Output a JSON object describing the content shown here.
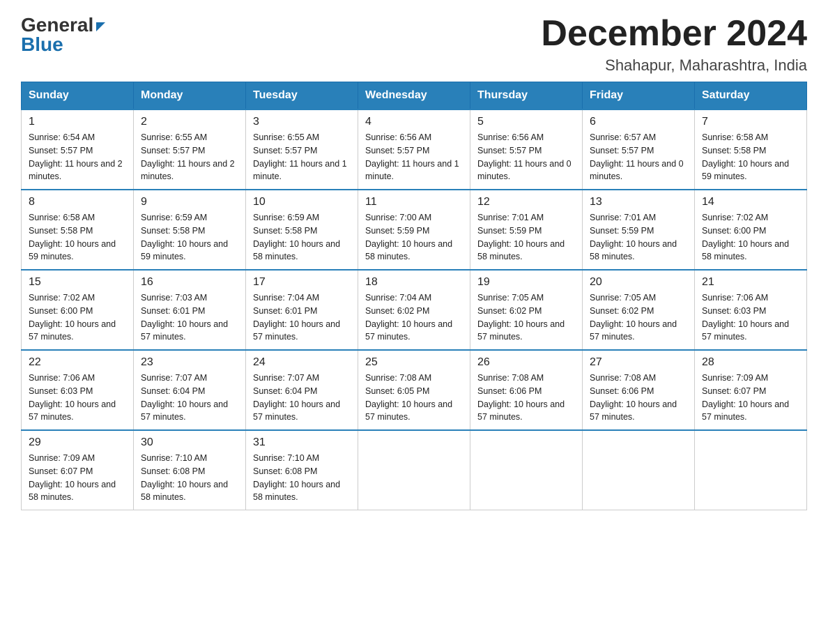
{
  "header": {
    "logo_general": "General",
    "logo_blue": "Blue",
    "month_title": "December 2024",
    "location": "Shahapur, Maharashtra, India"
  },
  "days_of_week": [
    "Sunday",
    "Monday",
    "Tuesday",
    "Wednesday",
    "Thursday",
    "Friday",
    "Saturday"
  ],
  "weeks": [
    [
      {
        "day": "1",
        "sunrise": "6:54 AM",
        "sunset": "5:57 PM",
        "daylight": "11 hours and 2 minutes."
      },
      {
        "day": "2",
        "sunrise": "6:55 AM",
        "sunset": "5:57 PM",
        "daylight": "11 hours and 2 minutes."
      },
      {
        "day": "3",
        "sunrise": "6:55 AM",
        "sunset": "5:57 PM",
        "daylight": "11 hours and 1 minute."
      },
      {
        "day": "4",
        "sunrise": "6:56 AM",
        "sunset": "5:57 PM",
        "daylight": "11 hours and 1 minute."
      },
      {
        "day": "5",
        "sunrise": "6:56 AM",
        "sunset": "5:57 PM",
        "daylight": "11 hours and 0 minutes."
      },
      {
        "day": "6",
        "sunrise": "6:57 AM",
        "sunset": "5:57 PM",
        "daylight": "11 hours and 0 minutes."
      },
      {
        "day": "7",
        "sunrise": "6:58 AM",
        "sunset": "5:58 PM",
        "daylight": "10 hours and 59 minutes."
      }
    ],
    [
      {
        "day": "8",
        "sunrise": "6:58 AM",
        "sunset": "5:58 PM",
        "daylight": "10 hours and 59 minutes."
      },
      {
        "day": "9",
        "sunrise": "6:59 AM",
        "sunset": "5:58 PM",
        "daylight": "10 hours and 59 minutes."
      },
      {
        "day": "10",
        "sunrise": "6:59 AM",
        "sunset": "5:58 PM",
        "daylight": "10 hours and 58 minutes."
      },
      {
        "day": "11",
        "sunrise": "7:00 AM",
        "sunset": "5:59 PM",
        "daylight": "10 hours and 58 minutes."
      },
      {
        "day": "12",
        "sunrise": "7:01 AM",
        "sunset": "5:59 PM",
        "daylight": "10 hours and 58 minutes."
      },
      {
        "day": "13",
        "sunrise": "7:01 AM",
        "sunset": "5:59 PM",
        "daylight": "10 hours and 58 minutes."
      },
      {
        "day": "14",
        "sunrise": "7:02 AM",
        "sunset": "6:00 PM",
        "daylight": "10 hours and 58 minutes."
      }
    ],
    [
      {
        "day": "15",
        "sunrise": "7:02 AM",
        "sunset": "6:00 PM",
        "daylight": "10 hours and 57 minutes."
      },
      {
        "day": "16",
        "sunrise": "7:03 AM",
        "sunset": "6:01 PM",
        "daylight": "10 hours and 57 minutes."
      },
      {
        "day": "17",
        "sunrise": "7:04 AM",
        "sunset": "6:01 PM",
        "daylight": "10 hours and 57 minutes."
      },
      {
        "day": "18",
        "sunrise": "7:04 AM",
        "sunset": "6:02 PM",
        "daylight": "10 hours and 57 minutes."
      },
      {
        "day": "19",
        "sunrise": "7:05 AM",
        "sunset": "6:02 PM",
        "daylight": "10 hours and 57 minutes."
      },
      {
        "day": "20",
        "sunrise": "7:05 AM",
        "sunset": "6:02 PM",
        "daylight": "10 hours and 57 minutes."
      },
      {
        "day": "21",
        "sunrise": "7:06 AM",
        "sunset": "6:03 PM",
        "daylight": "10 hours and 57 minutes."
      }
    ],
    [
      {
        "day": "22",
        "sunrise": "7:06 AM",
        "sunset": "6:03 PM",
        "daylight": "10 hours and 57 minutes."
      },
      {
        "day": "23",
        "sunrise": "7:07 AM",
        "sunset": "6:04 PM",
        "daylight": "10 hours and 57 minutes."
      },
      {
        "day": "24",
        "sunrise": "7:07 AM",
        "sunset": "6:04 PM",
        "daylight": "10 hours and 57 minutes."
      },
      {
        "day": "25",
        "sunrise": "7:08 AM",
        "sunset": "6:05 PM",
        "daylight": "10 hours and 57 minutes."
      },
      {
        "day": "26",
        "sunrise": "7:08 AM",
        "sunset": "6:06 PM",
        "daylight": "10 hours and 57 minutes."
      },
      {
        "day": "27",
        "sunrise": "7:08 AM",
        "sunset": "6:06 PM",
        "daylight": "10 hours and 57 minutes."
      },
      {
        "day": "28",
        "sunrise": "7:09 AM",
        "sunset": "6:07 PM",
        "daylight": "10 hours and 57 minutes."
      }
    ],
    [
      {
        "day": "29",
        "sunrise": "7:09 AM",
        "sunset": "6:07 PM",
        "daylight": "10 hours and 58 minutes."
      },
      {
        "day": "30",
        "sunrise": "7:10 AM",
        "sunset": "6:08 PM",
        "daylight": "10 hours and 58 minutes."
      },
      {
        "day": "31",
        "sunrise": "7:10 AM",
        "sunset": "6:08 PM",
        "daylight": "10 hours and 58 minutes."
      },
      null,
      null,
      null,
      null
    ]
  ]
}
